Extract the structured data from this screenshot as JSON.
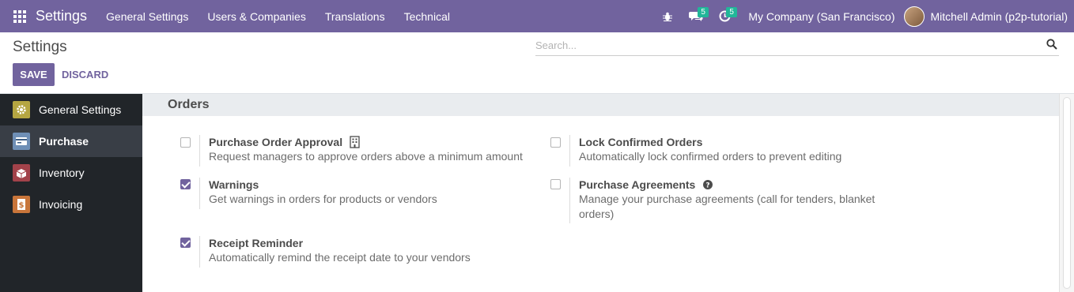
{
  "navbar": {
    "brand": "Settings",
    "menu": [
      "General Settings",
      "Users & Companies",
      "Translations",
      "Technical"
    ],
    "messages_count": "5",
    "activities_count": "5",
    "company": "My Company (San Francisco)",
    "user": "Mitchell Admin (p2p-tutorial)"
  },
  "control_panel": {
    "title": "Settings",
    "save_label": "SAVE",
    "discard_label": "DISCARD",
    "search_placeholder": "Search..."
  },
  "sidebar": {
    "items": [
      {
        "label": "General Settings",
        "icon": "gear-icon",
        "color": "#b5a642"
      },
      {
        "label": "Purchase",
        "icon": "purchase-card-icon",
        "color": "#6f8fb6",
        "active": true
      },
      {
        "label": "Inventory",
        "icon": "inventory-box-icon",
        "color": "#a2424a"
      },
      {
        "label": "Invoicing",
        "icon": "invoice-dollar-icon",
        "color": "#c8753a"
      }
    ]
  },
  "section": {
    "title": "Orders",
    "settings": [
      {
        "title": "Purchase Order Approval",
        "desc": "Request managers to approve orders above a minimum amount",
        "checked": false
      },
      {
        "title": "Lock Confirmed Orders",
        "desc": "Automatically lock confirmed orders to prevent editing",
        "checked": false
      },
      {
        "title": "Warnings",
        "desc": "Get warnings in orders for products or vendors",
        "checked": true
      },
      {
        "title": "Purchase Agreements",
        "desc": "Manage your purchase agreements (call for tenders, blanket orders)",
        "checked": false
      },
      {
        "title": "Receipt Reminder",
        "desc": "Automatically remind the receipt date to your vendors",
        "checked": true
      }
    ]
  },
  "colors": {
    "brand": "#71639e",
    "sidebar": "#212529",
    "badge": "#21b799"
  }
}
